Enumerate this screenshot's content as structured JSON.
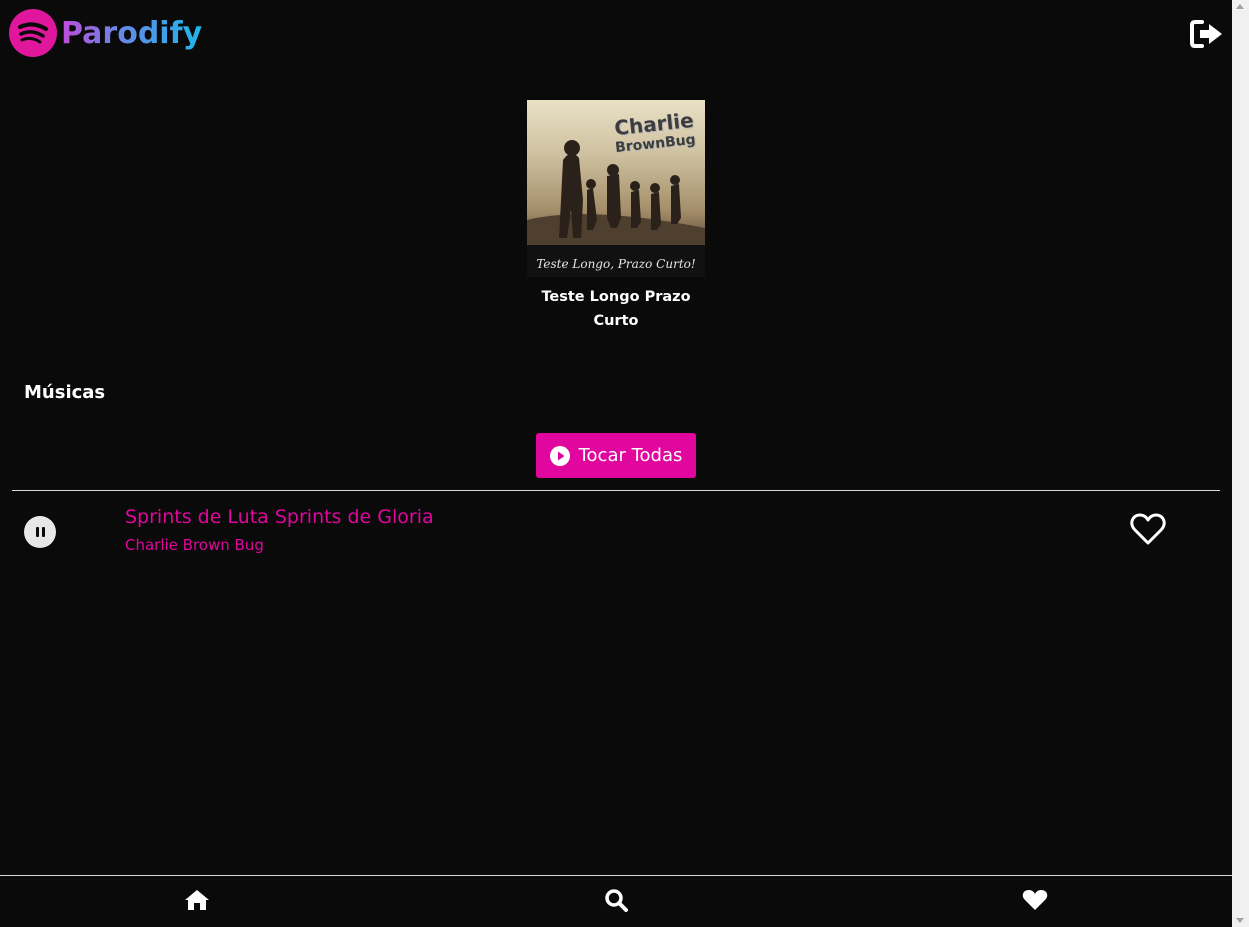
{
  "app": {
    "name": "Parodify"
  },
  "album": {
    "title": "Teste Longo Prazo Curto",
    "cover_title_line1": "Charlie",
    "cover_title_line2": "BrownBug",
    "cover_subtitle": "Teste Longo, Prazo Curto!"
  },
  "section": {
    "title": "Músicas"
  },
  "actions": {
    "play_all_label": "Tocar Todas"
  },
  "tracks": [
    {
      "title": "Sprints de Luta Sprints de Gloria",
      "artist": "Charlie Brown Bug",
      "state": "playing",
      "favorite": false
    }
  ],
  "nav": {
    "items": [
      "home-icon",
      "search-icon",
      "heart-icon"
    ]
  },
  "colors": {
    "accent": "#e0069e",
    "background": "#0a0a0a",
    "text": "#ffffff"
  }
}
